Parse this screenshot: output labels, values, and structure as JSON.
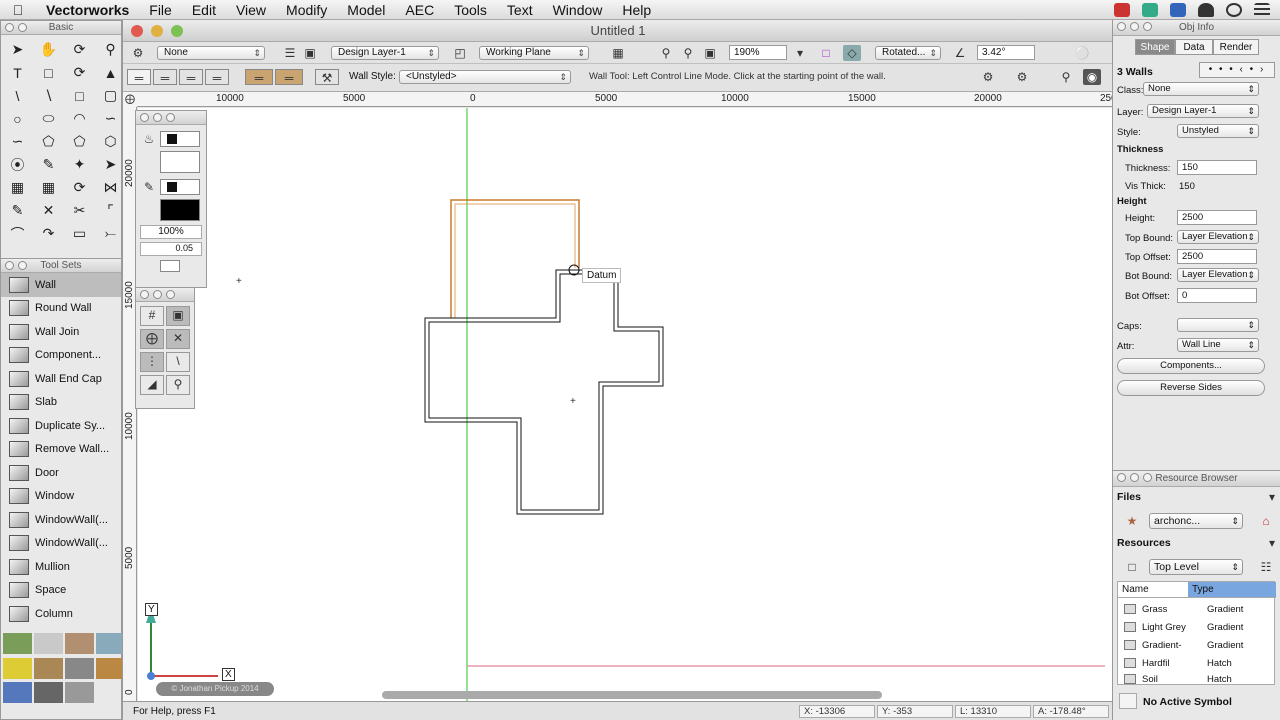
{
  "menubar": {
    "app": "Vectorworks",
    "items": [
      "File",
      "Edit",
      "View",
      "Modify",
      "Model",
      "AEC",
      "Tools",
      "Text",
      "Window",
      "Help"
    ]
  },
  "basic": {
    "title": "Basic"
  },
  "toolsets": {
    "title": "Tool Sets",
    "items": [
      "Wall",
      "Round Wall",
      "Wall Join",
      "Component...",
      "Wall End Cap",
      "Slab",
      "Duplicate Sy...",
      "Remove Wall...",
      "Door",
      "Window",
      "WindowWall(...",
      "WindowWall(...",
      "Mullion",
      "Space",
      "Column"
    ]
  },
  "document": {
    "title": "Untitled 1"
  },
  "viewbar": {
    "class": "None",
    "layer": "Design Layer-1",
    "plane": "Working Plane",
    "zoom": "190%",
    "rotated": "Rotated...",
    "angle": "3.42°"
  },
  "modebar": {
    "wall_style_label": "Wall Style:",
    "wall_style": "<Unstyled>",
    "help": "Wall Tool: Left Control Line Mode. Click at the starting point of the wall."
  },
  "ruler": {
    "h": [
      "10000",
      "5000",
      "0",
      "5000",
      "10000",
      "15000",
      "20000",
      "250"
    ],
    "v": [
      "20000",
      "15000",
      "10000",
      "5000",
      "0"
    ]
  },
  "attributes": {
    "zoom_value": "100%",
    "line_weight": "0.05"
  },
  "canvas": {
    "datum_label": "Datum",
    "x_axis": "X",
    "y_axis": "Y",
    "watermark": "© Jonathan Pickup 2014"
  },
  "status": {
    "help": "For Help, press F1",
    "x": "X: -13306",
    "y": "Y: -353",
    "l": "L: 13310",
    "a": "A: -178.48°"
  },
  "objinfo": {
    "title": "Obj Info",
    "tabs": [
      "Shape",
      "Data",
      "Render"
    ],
    "selection": "3 Walls",
    "class_label": "Class:",
    "class": "None",
    "layer_label": "Layer:",
    "layer": "Design Layer-1",
    "style_label": "Style:",
    "style": "Unstyled",
    "thickness_head": "Thickness",
    "thickness_label": "Thickness:",
    "thickness": "150",
    "vis_thick_label": "Vis Thick:",
    "vis_thick": "150",
    "height_head": "Height",
    "height_label": "Height:",
    "height": "2500",
    "top_bound_label": "Top Bound:",
    "top_bound": "Layer Elevation",
    "top_offset_label": "Top Offset:",
    "top_offset": "2500",
    "bot_bound_label": "Bot Bound:",
    "bot_bound": "Layer Elevation",
    "bot_offset_label": "Bot Offset:",
    "bot_offset": "0",
    "caps_label": "Caps:",
    "attr_label": "Attr:",
    "attr": "Wall Line",
    "components_btn": "Components...",
    "reverse_btn": "Reverse Sides"
  },
  "resources": {
    "title": "Resource Browser",
    "files_label": "Files",
    "file": "archonc...",
    "resources_label": "Resources",
    "folder": "Top Level",
    "col_name": "Name",
    "col_type": "Type",
    "rows": [
      {
        "name": "Grass",
        "type": "Gradient"
      },
      {
        "name": "Light Grey",
        "type": "Gradient"
      },
      {
        "name": "Gradient-",
        "type": "Gradient"
      },
      {
        "name": "Hardfil",
        "type": "Hatch"
      },
      {
        "name": "Soil",
        "type": "Hatch"
      }
    ],
    "symbol": "No Active Symbol"
  }
}
